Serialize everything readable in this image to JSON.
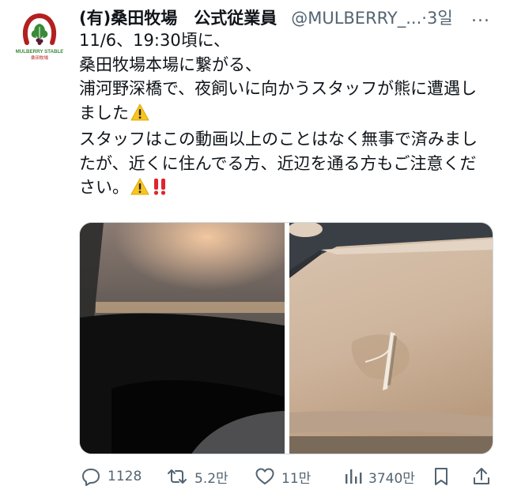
{
  "tweet": {
    "display_name": "(有)桑田牧場　公式従業員",
    "handle": "@MULBERRY_...",
    "separator": "·",
    "time": "3일",
    "more_label": "...",
    "avatar": {
      "top_text": "MULBERRY STABLE",
      "bottom_text": "桑田牧場"
    },
    "lines": [
      "11/6、19:30頃に、",
      "桑田牧場本場に繋がる、",
      "浦河野深橋で、夜飼いに向かうスタッフが熊に遭遇しました",
      "スタッフはこの動画以上のことはなく無事で済みましたが、近くに住んでる方、近辺を通る方もご注意ください。"
    ],
    "emojis": [
      "warning-emoji",
      "warning-emoji",
      "double-exclamation-emoji"
    ]
  },
  "media": {
    "photos": [
      {
        "name": "dashcam-night-photo",
        "description_icon": "photo"
      },
      {
        "name": "dented-car-hood-photo",
        "description_icon": "photo"
      }
    ]
  },
  "actions": {
    "reply_count": "1128",
    "repost_count": "5.2만",
    "like_count": "11만",
    "view_count": "3740만"
  },
  "colors": {
    "text": "#0f1419",
    "secondary": "#536471",
    "brand_green": "#3a8a3a",
    "brand_red": "#b32020"
  }
}
